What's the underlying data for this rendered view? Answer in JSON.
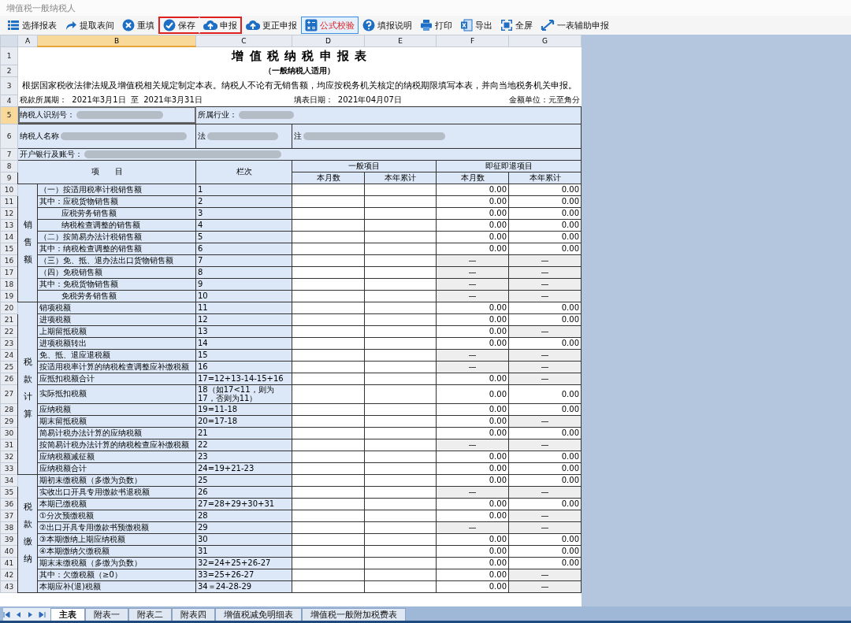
{
  "window": {
    "title": "增值税一般纳税人"
  },
  "toolbar": [
    {
      "label": "选择报表",
      "selected": false,
      "outlined": false
    },
    {
      "label": "提取表间",
      "selected": false,
      "outlined": false
    },
    {
      "label": "重填",
      "selected": false,
      "outlined": false
    },
    {
      "label": "保存",
      "selected": false,
      "outlined": true
    },
    {
      "label": "申报",
      "selected": false,
      "outlined": true
    },
    {
      "label": "更正申报",
      "selected": false,
      "outlined": false
    },
    {
      "label": "公式校验",
      "selected": true,
      "outlined": false
    },
    {
      "label": "填报说明",
      "selected": false,
      "outlined": false
    },
    {
      "label": "打印",
      "selected": false,
      "outlined": false
    },
    {
      "label": "导出",
      "selected": false,
      "outlined": false
    },
    {
      "label": "全屏",
      "selected": false,
      "outlined": false
    },
    {
      "label": "一表辅助申报",
      "selected": false,
      "outlined": false
    }
  ],
  "columns": [
    {
      "label": "A",
      "selected": false
    },
    {
      "label": "B",
      "selected": true
    },
    {
      "label": "C",
      "selected": false
    },
    {
      "label": "D",
      "selected": false
    },
    {
      "label": "E",
      "selected": false
    },
    {
      "label": "F",
      "selected": false
    },
    {
      "label": "G",
      "selected": false
    }
  ],
  "header_rows": [
    {
      "label": "1",
      "selected": false
    },
    {
      "label": "2",
      "selected": false
    },
    {
      "label": "3",
      "selected": false
    },
    {
      "label": "4",
      "selected": false
    },
    {
      "label": "5",
      "selected": true
    },
    {
      "label": "6",
      "selected": false
    },
    {
      "label": "7",
      "selected": false
    },
    {
      "label": "8",
      "selected": false
    },
    {
      "label": "9",
      "selected": false
    }
  ],
  "form": {
    "title": "增 值 税 纳 税 申 报 表",
    "subtitle": "（一般纳税人适用）",
    "description": "根据国家税收法律法规及增值税相关规定制定本表。纳税人不论有无销售额，均应按税务机关核定的纳税期限填写本表，并向当地税务机关申报。",
    "period": "税款所属期：  2021年3月1日  至  2021年3月31日",
    "fill_date": "填表日期：  2021年04月07日",
    "unit": "金额单位：元至角分",
    "taxpayer_id_label": "纳税人识别号：",
    "industry_label": "所属行业：",
    "name_label": "纳税人名称",
    "legal_label": "法",
    "address_label": "注",
    "bank_label": "开户银行及账号：",
    "item_header": "项　　目",
    "line_header": "栏次",
    "general_header": "一般项目",
    "refund_header": "即征即退项目",
    "sub_headers": [
      "本月数",
      "本年累计",
      "本月数",
      "本年累计"
    ]
  },
  "groups": [
    {
      "label": "销售额",
      "rows": [
        {
          "row": "10",
          "kind": "item",
          "item": "（一）按适用税率计税销售额",
          "line": "1",
          "f": "0.00",
          "g": "0.00"
        },
        {
          "row": "11",
          "kind": "item",
          "item": "其中：应税货物销售额",
          "line": "2",
          "f": "0.00",
          "g": "0.00"
        },
        {
          "row": "12",
          "kind": "sub",
          "item": "应税劳务销售额",
          "line": "3",
          "f": "0.00",
          "g": "0.00"
        },
        {
          "row": "13",
          "kind": "sub",
          "item": "纳税检查调整的销售额",
          "line": "4",
          "f": "0.00",
          "g": "0.00"
        },
        {
          "row": "14",
          "kind": "item",
          "item": "（二）按简易办法计税销售额",
          "line": "5",
          "f": "0.00",
          "g": "0.00"
        },
        {
          "row": "15",
          "kind": "item",
          "item": "其中：纳税检查调整的销售额",
          "line": "6",
          "f": "0.00",
          "g": "0.00"
        },
        {
          "row": "16",
          "kind": "item",
          "item": "（三）免、抵、退办法出口货物销售额",
          "line": "7",
          "f": "—",
          "g": "—"
        },
        {
          "row": "17",
          "kind": "item",
          "item": "（四）免税销售额",
          "line": "8",
          "f": "—",
          "g": "—"
        },
        {
          "row": "18",
          "kind": "item",
          "item": "其中：免税货物销售额",
          "line": "9",
          "f": "—",
          "g": "—"
        },
        {
          "row": "19",
          "kind": "sub",
          "item": "免税劳务销售额",
          "line": "10",
          "f": "—",
          "g": "—"
        }
      ]
    },
    {
      "label": "税款计算",
      "rows": [
        {
          "row": "20",
          "kind": "item",
          "item": "销项税额",
          "line": "11",
          "f": "0.00",
          "g": "0.00"
        },
        {
          "row": "21",
          "kind": "item",
          "item": "进项税额",
          "line": "12",
          "f": "0.00",
          "g": "0.00"
        },
        {
          "row": "22",
          "kind": "item",
          "item": "上期留抵税额",
          "line": "13",
          "f": "0.00",
          "g": "—"
        },
        {
          "row": "23",
          "kind": "item",
          "item": "进项税额转出",
          "line": "14",
          "f": "0.00",
          "g": "0.00"
        },
        {
          "row": "24",
          "kind": "item",
          "item": "免、抵、退应退税额",
          "line": "15",
          "f": "—",
          "g": "—"
        },
        {
          "row": "25",
          "kind": "item",
          "item": "按适用税率计算的纳税检查调整应补缴税额",
          "line": "16",
          "f": "—",
          "g": "—"
        },
        {
          "row": "26",
          "kind": "item",
          "item": "应抵扣税额合计",
          "line": "17=12+13-14-15+16",
          "f": "0.00",
          "g": "—"
        },
        {
          "row": "27",
          "kind": "item",
          "item": "实际抵扣税额",
          "line": "18（如17<11，则为17，否则为11）",
          "f": "0.00",
          "g": "0.00"
        },
        {
          "row": "28",
          "kind": "item",
          "item": "应纳税额",
          "line": "19=11-18",
          "f": "0.00",
          "g": "0.00"
        },
        {
          "row": "29",
          "kind": "item",
          "item": "期末留抵税额",
          "line": "20=17-18",
          "f": "0.00",
          "g": "—"
        },
        {
          "row": "30",
          "kind": "item",
          "item": "简易计税办法计算的应纳税额",
          "line": "21",
          "f": "0.00",
          "g": "0.00"
        },
        {
          "row": "31",
          "kind": "item",
          "item": "按简易计税办法计算的纳税检查应补缴税额",
          "line": "22",
          "f": "—",
          "g": "—"
        },
        {
          "row": "32",
          "kind": "item",
          "item": "应纳税额减征额",
          "line": "23",
          "f": "0.00",
          "g": "0.00"
        },
        {
          "row": "33",
          "kind": "item",
          "item": "应纳税额合计",
          "line": "24=19+21-23",
          "f": "0.00",
          "g": "0.00"
        }
      ]
    },
    {
      "label": "税款缴纳",
      "rows": [
        {
          "row": "34",
          "kind": "item",
          "item": "期初未缴税额（多缴为负数）",
          "line": "25",
          "f": "0.00",
          "g": "0.00"
        },
        {
          "row": "35",
          "kind": "item",
          "item": "实收出口开具专用缴款书退税额",
          "line": "26",
          "f": "—",
          "g": "—"
        },
        {
          "row": "36",
          "kind": "item",
          "item": "本期已缴税额",
          "line": "27=28+29+30+31",
          "f": "0.00",
          "g": "0.00"
        },
        {
          "row": "37",
          "kind": "item",
          "item": "①分次预缴税额",
          "line": "28",
          "f": "0.00",
          "g": "—"
        },
        {
          "row": "38",
          "kind": "item",
          "item": "②出口开具专用缴款书预缴税额",
          "line": "29",
          "f": "—",
          "g": "—"
        },
        {
          "row": "39",
          "kind": "item",
          "item": "③本期缴纳上期应纳税额",
          "line": "30",
          "f": "0.00",
          "g": "0.00"
        },
        {
          "row": "40",
          "kind": "item",
          "item": "④本期缴纳欠缴税额",
          "line": "31",
          "f": "0.00",
          "g": "0.00"
        },
        {
          "row": "41",
          "kind": "item",
          "item": "期末未缴税额（多缴为负数）",
          "line": "32=24+25+26-27",
          "f": "0.00",
          "g": "0.00"
        },
        {
          "row": "42",
          "kind": "item",
          "item": "其中：欠缴税额（≥0）",
          "line": "33=25+26-27",
          "f": "0.00",
          "g": "—"
        },
        {
          "row": "43",
          "kind": "item",
          "item": "本期应补(退)税额",
          "line": "34＝24-28-29",
          "f": "0.00",
          "g": "—"
        }
      ]
    }
  ],
  "sheet_tabs": [
    {
      "label": "主表",
      "selected": true
    },
    {
      "label": "附表一",
      "selected": false
    },
    {
      "label": "附表二",
      "selected": false
    },
    {
      "label": "附表四",
      "selected": false
    },
    {
      "label": "增值税减免明细表",
      "selected": false
    },
    {
      "label": "增值税一般附加税费表",
      "selected": false
    }
  ]
}
